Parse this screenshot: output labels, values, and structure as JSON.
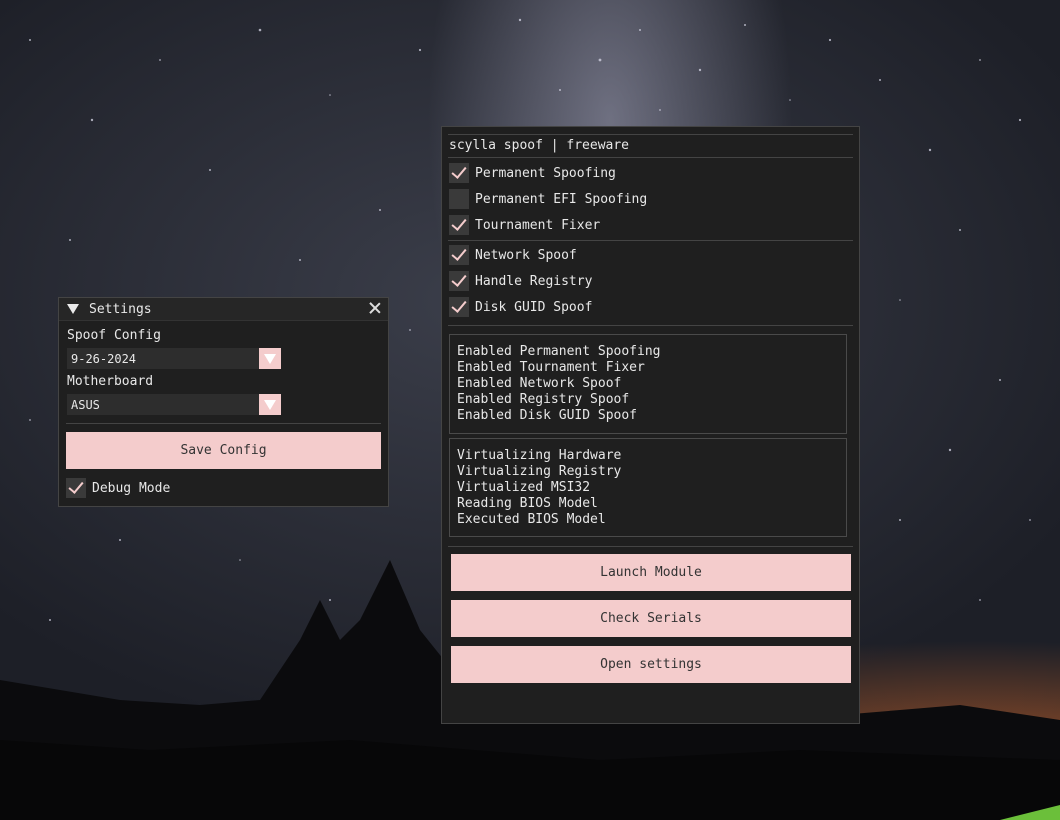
{
  "settings_window": {
    "title": "Settings",
    "spoof_config_label": "Spoof Config",
    "spoof_config_value": "9-26-2024",
    "motherboard_label": "Motherboard",
    "motherboard_value": "ASUS",
    "save_button": "Save Config",
    "debug_mode": {
      "label": "Debug Mode",
      "checked": true
    }
  },
  "main_window": {
    "title": "scylla spoof | freeware",
    "options_group1": [
      {
        "label": "Permanent Spoofing",
        "checked": true
      },
      {
        "label": "Permanent EFI Spoofing",
        "checked": false
      },
      {
        "label": "Tournament Fixer",
        "checked": true
      }
    ],
    "options_group2": [
      {
        "label": "Network Spoof",
        "checked": true
      },
      {
        "label": "Handle Registry",
        "checked": true
      },
      {
        "label": "Disk GUID Spoof",
        "checked": true
      }
    ],
    "log_enabled": [
      "Enabled Permanent Spoofing",
      "Enabled Tournament Fixer",
      "Enabled Network Spoof",
      "Enabled Registry Spoof",
      "Enabled Disk GUID Spoof"
    ],
    "log_status": [
      "Virtualizing Hardware",
      "Virtualizing Registry",
      "Virtualized MSI32",
      "Reading BIOS Model",
      "Executed BIOS Model"
    ],
    "buttons": {
      "launch": "Launch Module",
      "check": "Check Serials",
      "open_settings": "Open settings"
    }
  },
  "colors": {
    "accent": "#f4cccc",
    "window_bg": "#1f1f1f",
    "check_bg": "#3a3a3a"
  },
  "icons": [
    "collapse-triangle-icon",
    "close-icon",
    "dropdown-arrow-icon",
    "checkmark-icon"
  ]
}
